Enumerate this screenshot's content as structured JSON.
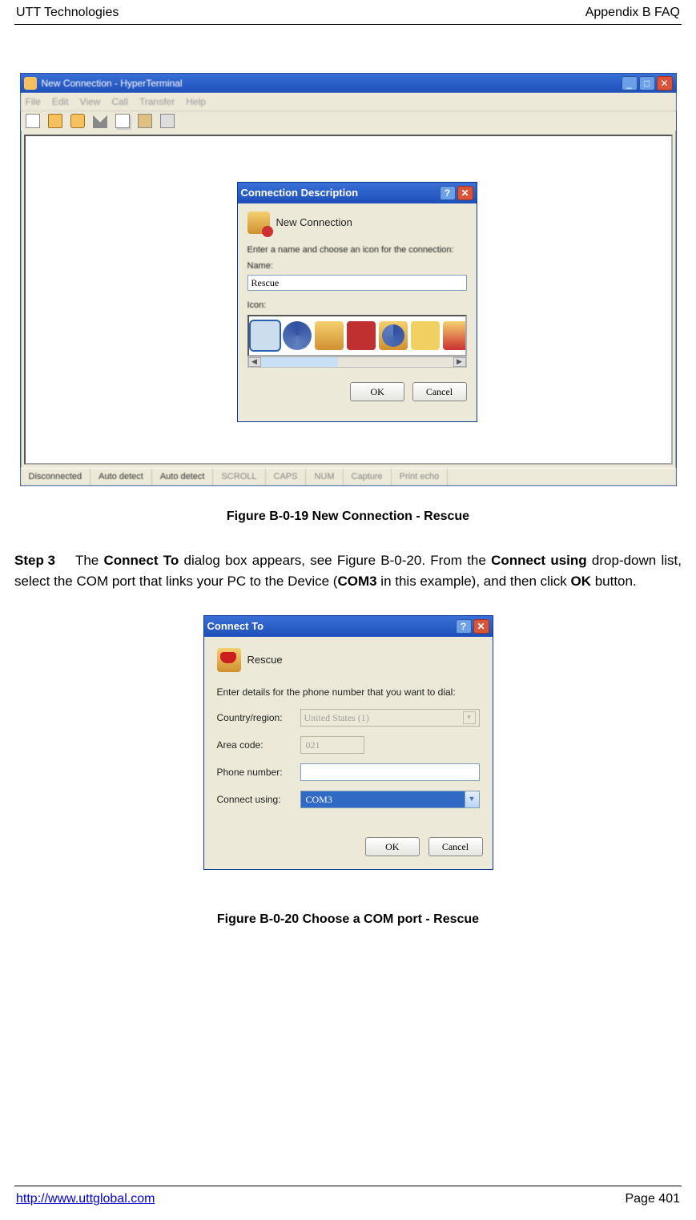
{
  "header": {
    "left": "UTT Technologies",
    "right": "Appendix B FAQ"
  },
  "footer": {
    "url": "http://www.uttglobal.com",
    "page": "Page 401"
  },
  "figure1_caption": "Figure B-0-19 New Connection - Rescue",
  "figure2_caption": "Figure B-0-20 Choose a COM port - Rescue",
  "step": {
    "label": "Step 3",
    "text_prefix": "The ",
    "b1": "Connect To",
    "mid1": " dialog box appears, see Figure B-0-20. From the ",
    "b2": "Connect using",
    "mid2": " drop-down list, select the COM port that links your PC to the Device (",
    "b3": "COM3",
    "mid3": " in this example), and then click ",
    "b4": "OK",
    "mid4": " button."
  },
  "win1": {
    "title": "New Connection - HyperTerminal",
    "menu": [
      "File",
      "Edit",
      "View",
      "Call",
      "Transfer",
      "Help"
    ],
    "status": [
      "Disconnected",
      "Auto detect",
      "Auto detect",
      "SCROLL",
      "CAPS",
      "NUM",
      "Capture",
      "Print echo"
    ]
  },
  "dlg1": {
    "title": "Connection Description",
    "heading": "New Connection",
    "prompt": "Enter a name and choose an icon for the connection:",
    "name_label": "Name:",
    "name_value": "Rescue",
    "icon_label": "Icon:",
    "ok": "OK",
    "cancel": "Cancel"
  },
  "dlg2": {
    "title": "Connect To",
    "name": "Rescue",
    "hint": "Enter details for the phone number that you want to dial:",
    "country_label": "Country/region:",
    "country_value": "United States (1)",
    "area_label": "Area code:",
    "area_value": "021",
    "phone_label": "Phone number:",
    "phone_value": "",
    "connect_label": "Connect using:",
    "connect_value": "COM3",
    "ok": "OK",
    "cancel": "Cancel"
  }
}
